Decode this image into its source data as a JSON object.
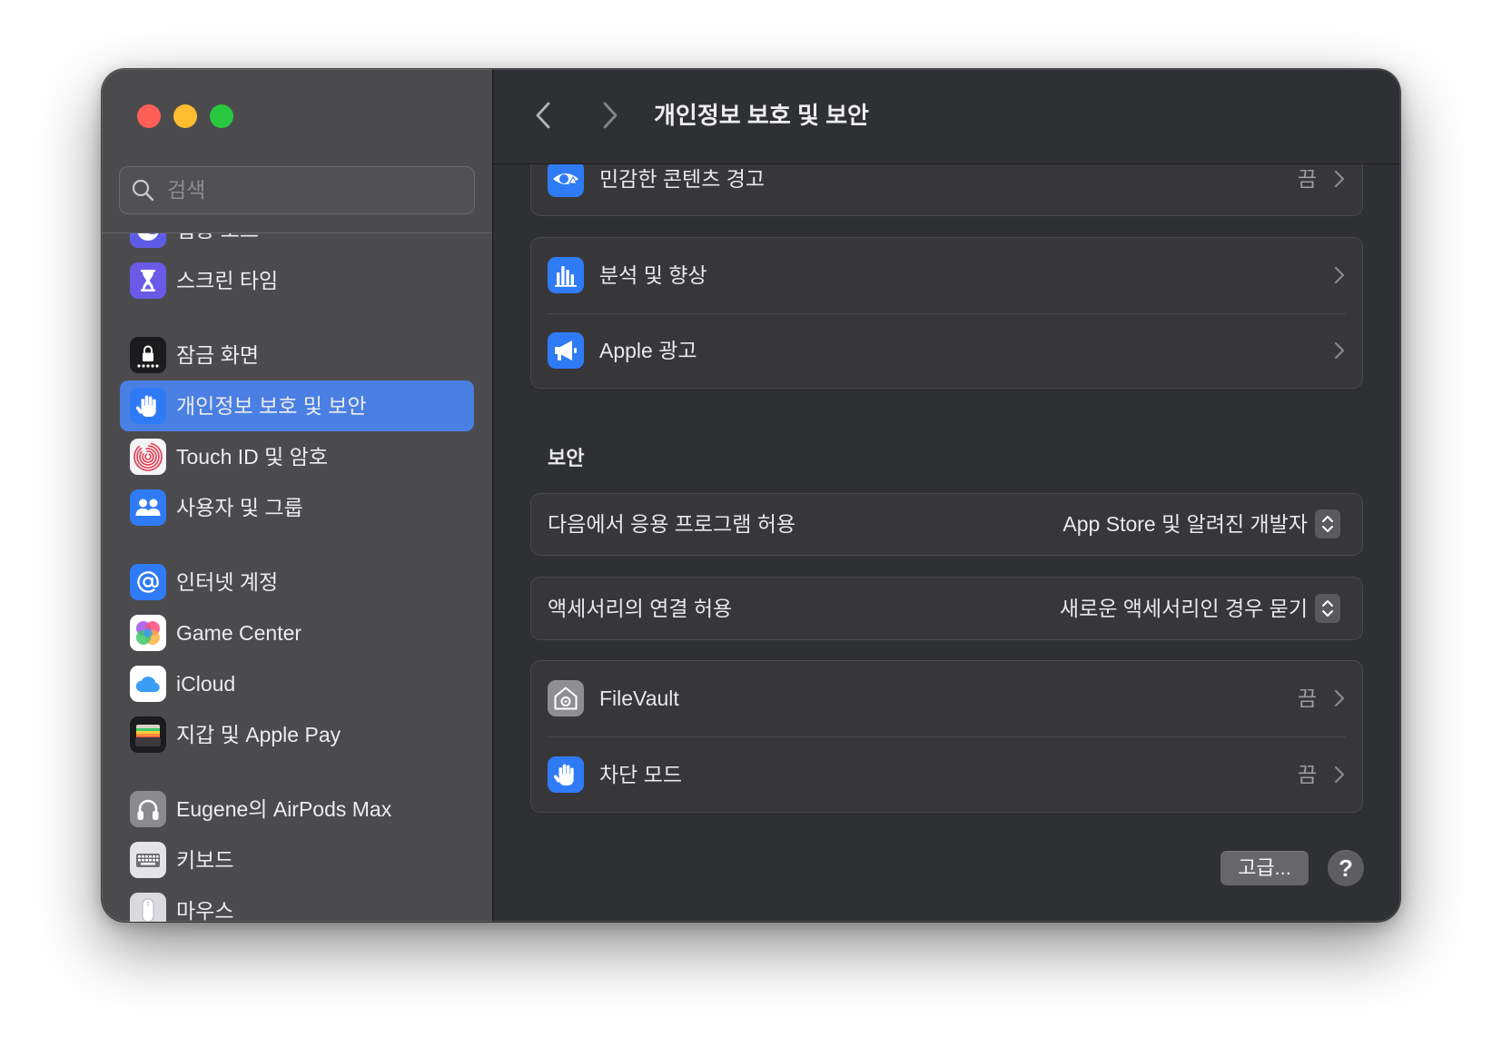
{
  "window": {
    "title": "개인정보 보호 및 보안"
  },
  "search": {
    "placeholder": "검색",
    "icon": "search-icon"
  },
  "sidebar": {
    "items": [
      {
        "label": "집중 모드",
        "icon": "focus-moon-icon"
      },
      {
        "label": "스크린 타임",
        "icon": "hourglass-icon"
      },
      {
        "label": "잠금 화면",
        "icon": "lock-screen-icon"
      },
      {
        "label": "개인정보 보호 및 보안",
        "icon": "privacy-hand-icon",
        "selected": true
      },
      {
        "label": "Touch ID 및 암호",
        "icon": "fingerprint-icon"
      },
      {
        "label": "사용자 및 그룹",
        "icon": "users-icon"
      },
      {
        "label": "인터넷 계정",
        "icon": "at-sign-icon"
      },
      {
        "label": "Game Center",
        "icon": "game-center-icon"
      },
      {
        "label": "iCloud",
        "icon": "icloud-icon"
      },
      {
        "label": "지갑 및 Apple Pay",
        "icon": "wallet-icon"
      },
      {
        "label": "Eugene의 AirPods Max",
        "icon": "headphones-icon"
      },
      {
        "label": "키보드",
        "icon": "keyboard-icon"
      },
      {
        "label": "마우스",
        "icon": "mouse-icon"
      }
    ]
  },
  "toolbar": {
    "back_icon": "chevron-left-icon",
    "forward_icon": "chevron-right-icon"
  },
  "privacy": {
    "rows": [
      {
        "label": "민감한 콘텐츠 경고",
        "value": "끔",
        "icon": "eye-warning-icon"
      },
      {
        "label": "분석 및 향상",
        "icon": "analytics-chart-icon"
      },
      {
        "label": "Apple 광고",
        "icon": "megaphone-icon"
      }
    ]
  },
  "security": {
    "title": "보안",
    "allow_apps": {
      "label": "다음에서 응용 프로그램 허용",
      "value": "App Store 및 알려진 개발자"
    },
    "accessories": {
      "label": "액세서리의 연결 허용",
      "value": "새로운 액세서리인 경우 묻기"
    },
    "rows": [
      {
        "label": "FileVault",
        "value": "끔",
        "icon": "filevault-icon"
      },
      {
        "label": "차단 모드",
        "value": "끔",
        "icon": "lockdown-hand-icon"
      }
    ]
  },
  "footer": {
    "advanced_label": "고급...",
    "help_label": "?"
  },
  "colors": {
    "accent": "#4a7fe3",
    "close": "#ff5f57",
    "minimize": "#febc2e",
    "zoom": "#28c840",
    "icon_blue": "#3478f6",
    "icon_purple": "#5e5ce6"
  }
}
